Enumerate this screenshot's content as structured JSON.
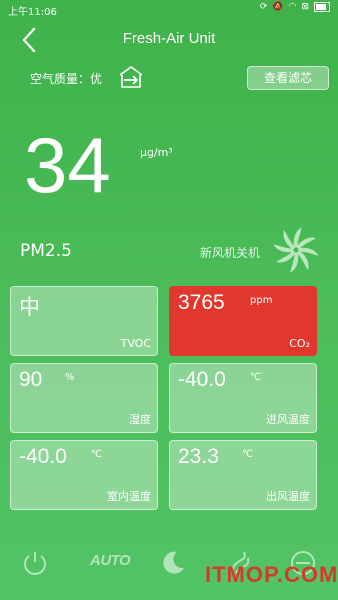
{
  "status_bar": {
    "time": "上午11:06"
  },
  "header": {
    "title": "Fresh-Air Unit"
  },
  "air_quality": {
    "label": "空气质量：优"
  },
  "filter_button": {
    "label": "查看滤芯"
  },
  "pm25": {
    "value": "34",
    "unit": "μg/m³",
    "label": "PM2.5"
  },
  "fan": {
    "status": "新风机关机"
  },
  "cards": [
    {
      "value": "中",
      "unit": "",
      "label": "TVOC"
    },
    {
      "value": "3765",
      "unit": "ppm",
      "label": "CO₂",
      "color": "#e0382c"
    },
    {
      "value": "90",
      "unit": "%",
      "label": "湿度"
    },
    {
      "value": "-40.0",
      "unit": "℃",
      "label": "进风温度"
    },
    {
      "value": "-40.0",
      "unit": "℃",
      "label": "室内温度"
    },
    {
      "value": "23.3",
      "unit": "℃",
      "label": "出风温度"
    }
  ],
  "bottom_bar": {
    "auto_label": "AUTO"
  },
  "watermark": {
    "text": "ITMOP.COM"
  },
  "colors": {
    "background": "#45b853",
    "alert": "#e0382c"
  }
}
